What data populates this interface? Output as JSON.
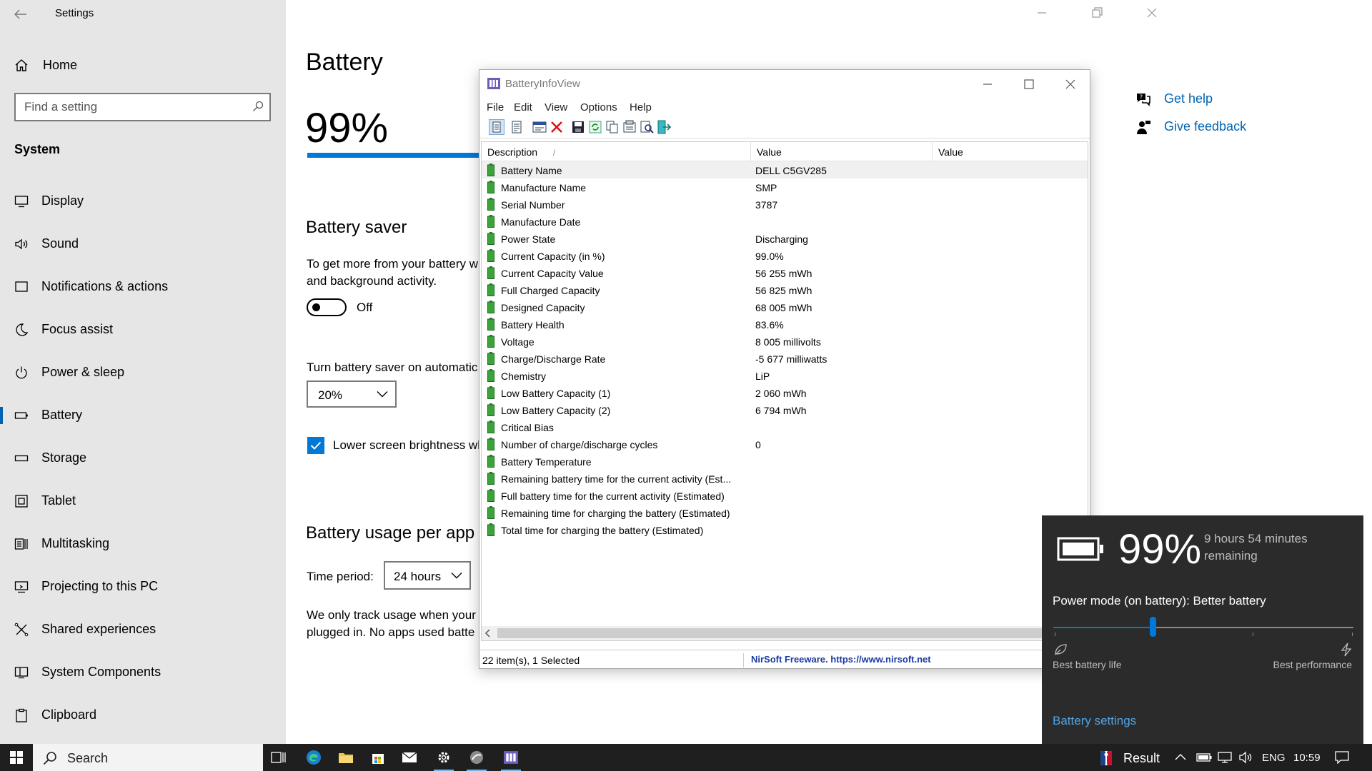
{
  "settings": {
    "title": "Settings",
    "home": "Home",
    "search_placeholder": "Find a setting",
    "section": "System",
    "nav": [
      {
        "label": "Display",
        "icon": "display-icon"
      },
      {
        "label": "Sound",
        "icon": "speaker-icon"
      },
      {
        "label": "Notifications & actions",
        "icon": "notification-icon"
      },
      {
        "label": "Focus assist",
        "icon": "moon-icon"
      },
      {
        "label": "Power & sleep",
        "icon": "power-icon"
      },
      {
        "label": "Battery",
        "icon": "battery-icon",
        "active": true
      },
      {
        "label": "Storage",
        "icon": "storage-icon"
      },
      {
        "label": "Tablet",
        "icon": "tablet-icon"
      },
      {
        "label": "Multitasking",
        "icon": "multitasking-icon"
      },
      {
        "label": "Projecting to this PC",
        "icon": "projecting-icon"
      },
      {
        "label": "Shared experiences",
        "icon": "shared-icon"
      },
      {
        "label": "System Components",
        "icon": "system-components-icon"
      },
      {
        "label": "Clipboard",
        "icon": "clipboard-icon"
      }
    ]
  },
  "main": {
    "title": "Battery",
    "percent": "99%",
    "charge_level": 0.99,
    "saver_heading": "Battery saver",
    "saver_desc_1": "To get more from your battery w",
    "saver_desc_2": "and background activity.",
    "saver_state": "Off",
    "auto_label": "Turn battery saver on automatic",
    "threshold": "20%",
    "brightness_label": "Lower screen brightness wh",
    "usage_heading": "Battery usage per app",
    "time_label": "Time period:",
    "time_period": "24 hours",
    "track_1": "We only track usage when your",
    "track_2": "plugged in. No apps used batte"
  },
  "help": {
    "get_help": "Get help",
    "give_feedback": "Give feedback"
  },
  "biv": {
    "title": "BatteryInfoView",
    "menu": [
      "File",
      "Edit",
      "View",
      "Options",
      "Help"
    ],
    "columns": [
      "Description",
      "Value",
      "Value"
    ],
    "sort_mark": "/",
    "rows": [
      {
        "desc": "Battery Name",
        "value": "DELL C5GV285"
      },
      {
        "desc": "Manufacture Name",
        "value": "SMP"
      },
      {
        "desc": "Serial Number",
        "value": "3787"
      },
      {
        "desc": "Manufacture Date",
        "value": ""
      },
      {
        "desc": "Power State",
        "value": "Discharging"
      },
      {
        "desc": "Current Capacity (in %)",
        "value": "99.0%"
      },
      {
        "desc": "Current Capacity Value",
        "value": "56 255 mWh"
      },
      {
        "desc": "Full Charged Capacity",
        "value": "56 825 mWh"
      },
      {
        "desc": "Designed Capacity",
        "value": "68 005 mWh"
      },
      {
        "desc": "Battery Health",
        "value": "83.6%"
      },
      {
        "desc": "Voltage",
        "value": "8 005 millivolts"
      },
      {
        "desc": "Charge/Discharge Rate",
        "value": "-5 677 milliwatts"
      },
      {
        "desc": "Chemistry",
        "value": "LiP"
      },
      {
        "desc": "Low Battery Capacity (1)",
        "value": "2 060 mWh"
      },
      {
        "desc": "Low Battery Capacity (2)",
        "value": "6 794 mWh"
      },
      {
        "desc": "Critical Bias",
        "value": ""
      },
      {
        "desc": "Number of charge/discharge cycles",
        "value": "0"
      },
      {
        "desc": "Battery Temperature",
        "value": ""
      },
      {
        "desc": "Remaining battery time for the current activity (Est...",
        "value": ""
      },
      {
        "desc": "Full battery time for the current activity (Estimated)",
        "value": ""
      },
      {
        "desc": "Remaining time for charging the battery (Estimated)",
        "value": ""
      },
      {
        "desc": "Total  time for charging the battery (Estimated)",
        "value": ""
      }
    ],
    "status_count": "22 item(s), 1 Selected",
    "status_credit": "NirSoft Freeware. https://www.nirsoft.net"
  },
  "flyout": {
    "percent": "99%",
    "remaining_1": "9 hours 54 minutes",
    "remaining_2": "remaining",
    "mode": "Power mode (on battery): Better battery",
    "slider_level": 0.33,
    "best_life": "Best battery life",
    "best_perf": "Best performance",
    "settings_link": "Battery settings"
  },
  "taskbar": {
    "search": "Search",
    "result": "Result",
    "lang": "ENG",
    "time": "10:59"
  },
  "colors": {
    "accent": "#0078d7",
    "link": "#0063b1",
    "sidebar_bg": "#e6e6e6",
    "flyout_bg": "#2b2b2b",
    "taskbar_bg": "#1f1f1f",
    "battery_green": "#3aa33a"
  }
}
